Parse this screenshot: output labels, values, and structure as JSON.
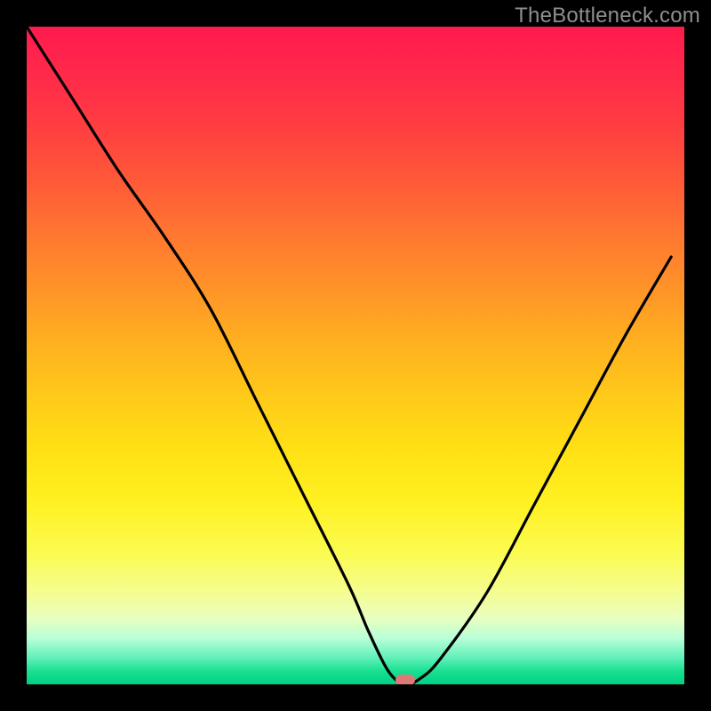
{
  "watermark": "TheBottleneck.com",
  "marker": {
    "x_pct": 57.5,
    "y_pct": 99.3
  },
  "chart_data": {
    "type": "line",
    "title": "",
    "xlabel": "",
    "ylabel": "",
    "xlim": [
      0,
      100
    ],
    "ylim": [
      0,
      100
    ],
    "grid": false,
    "legend": false,
    "series": [
      {
        "name": "bottleneck-curve",
        "x": [
          0,
          7,
          14,
          21,
          28,
          35,
          42,
          49,
          52,
          55,
          57.5,
          60,
          63,
          70,
          77,
          84,
          91,
          98
        ],
        "values": [
          100,
          89,
          78,
          68,
          57,
          43,
          29,
          15,
          8,
          2,
          0,
          1,
          4,
          14,
          27,
          40,
          53,
          65
        ]
      }
    ],
    "annotations": [
      {
        "type": "marker",
        "x": 57.5,
        "y": 0
      }
    ],
    "background": {
      "type": "vertical-gradient",
      "stops": [
        {
          "pct": 0,
          "color": "#ff1a4d"
        },
        {
          "pct": 50,
          "color": "#ffb020"
        },
        {
          "pct": 80,
          "color": "#fbfb50"
        },
        {
          "pct": 100,
          "color": "#00d084"
        }
      ]
    }
  }
}
